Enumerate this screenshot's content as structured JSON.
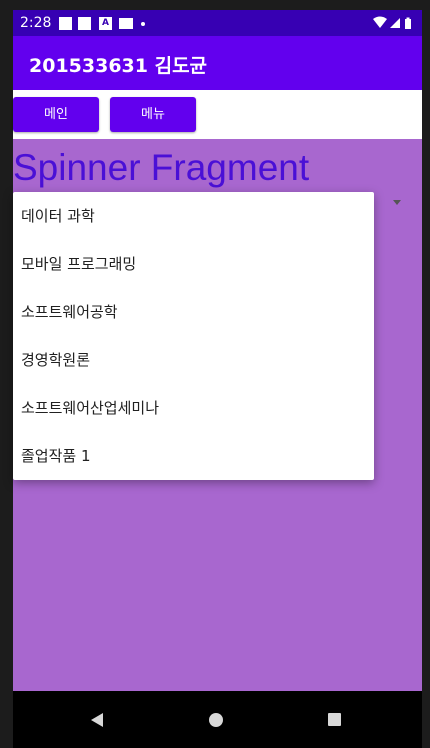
{
  "status_bar": {
    "time": "2:28"
  },
  "app_bar": {
    "title": "201533631 김도균"
  },
  "buttons": {
    "main_label": "메인",
    "menu_label": "메뉴"
  },
  "content": {
    "title": "Spinner Fragment"
  },
  "dropdown": {
    "items": [
      {
        "label": "데이터 과학"
      },
      {
        "label": "모바일 프로그래밍"
      },
      {
        "label": "소프트웨어공학"
      },
      {
        "label": "경영학원론"
      },
      {
        "label": "소프트웨어산업세미나"
      },
      {
        "label": "졸업작품 1"
      }
    ]
  },
  "colors": {
    "status_bar": "#3700b3",
    "app_bar": "#6200ee",
    "content_bg": "#a867cf",
    "title_text": "#4a10d6"
  }
}
